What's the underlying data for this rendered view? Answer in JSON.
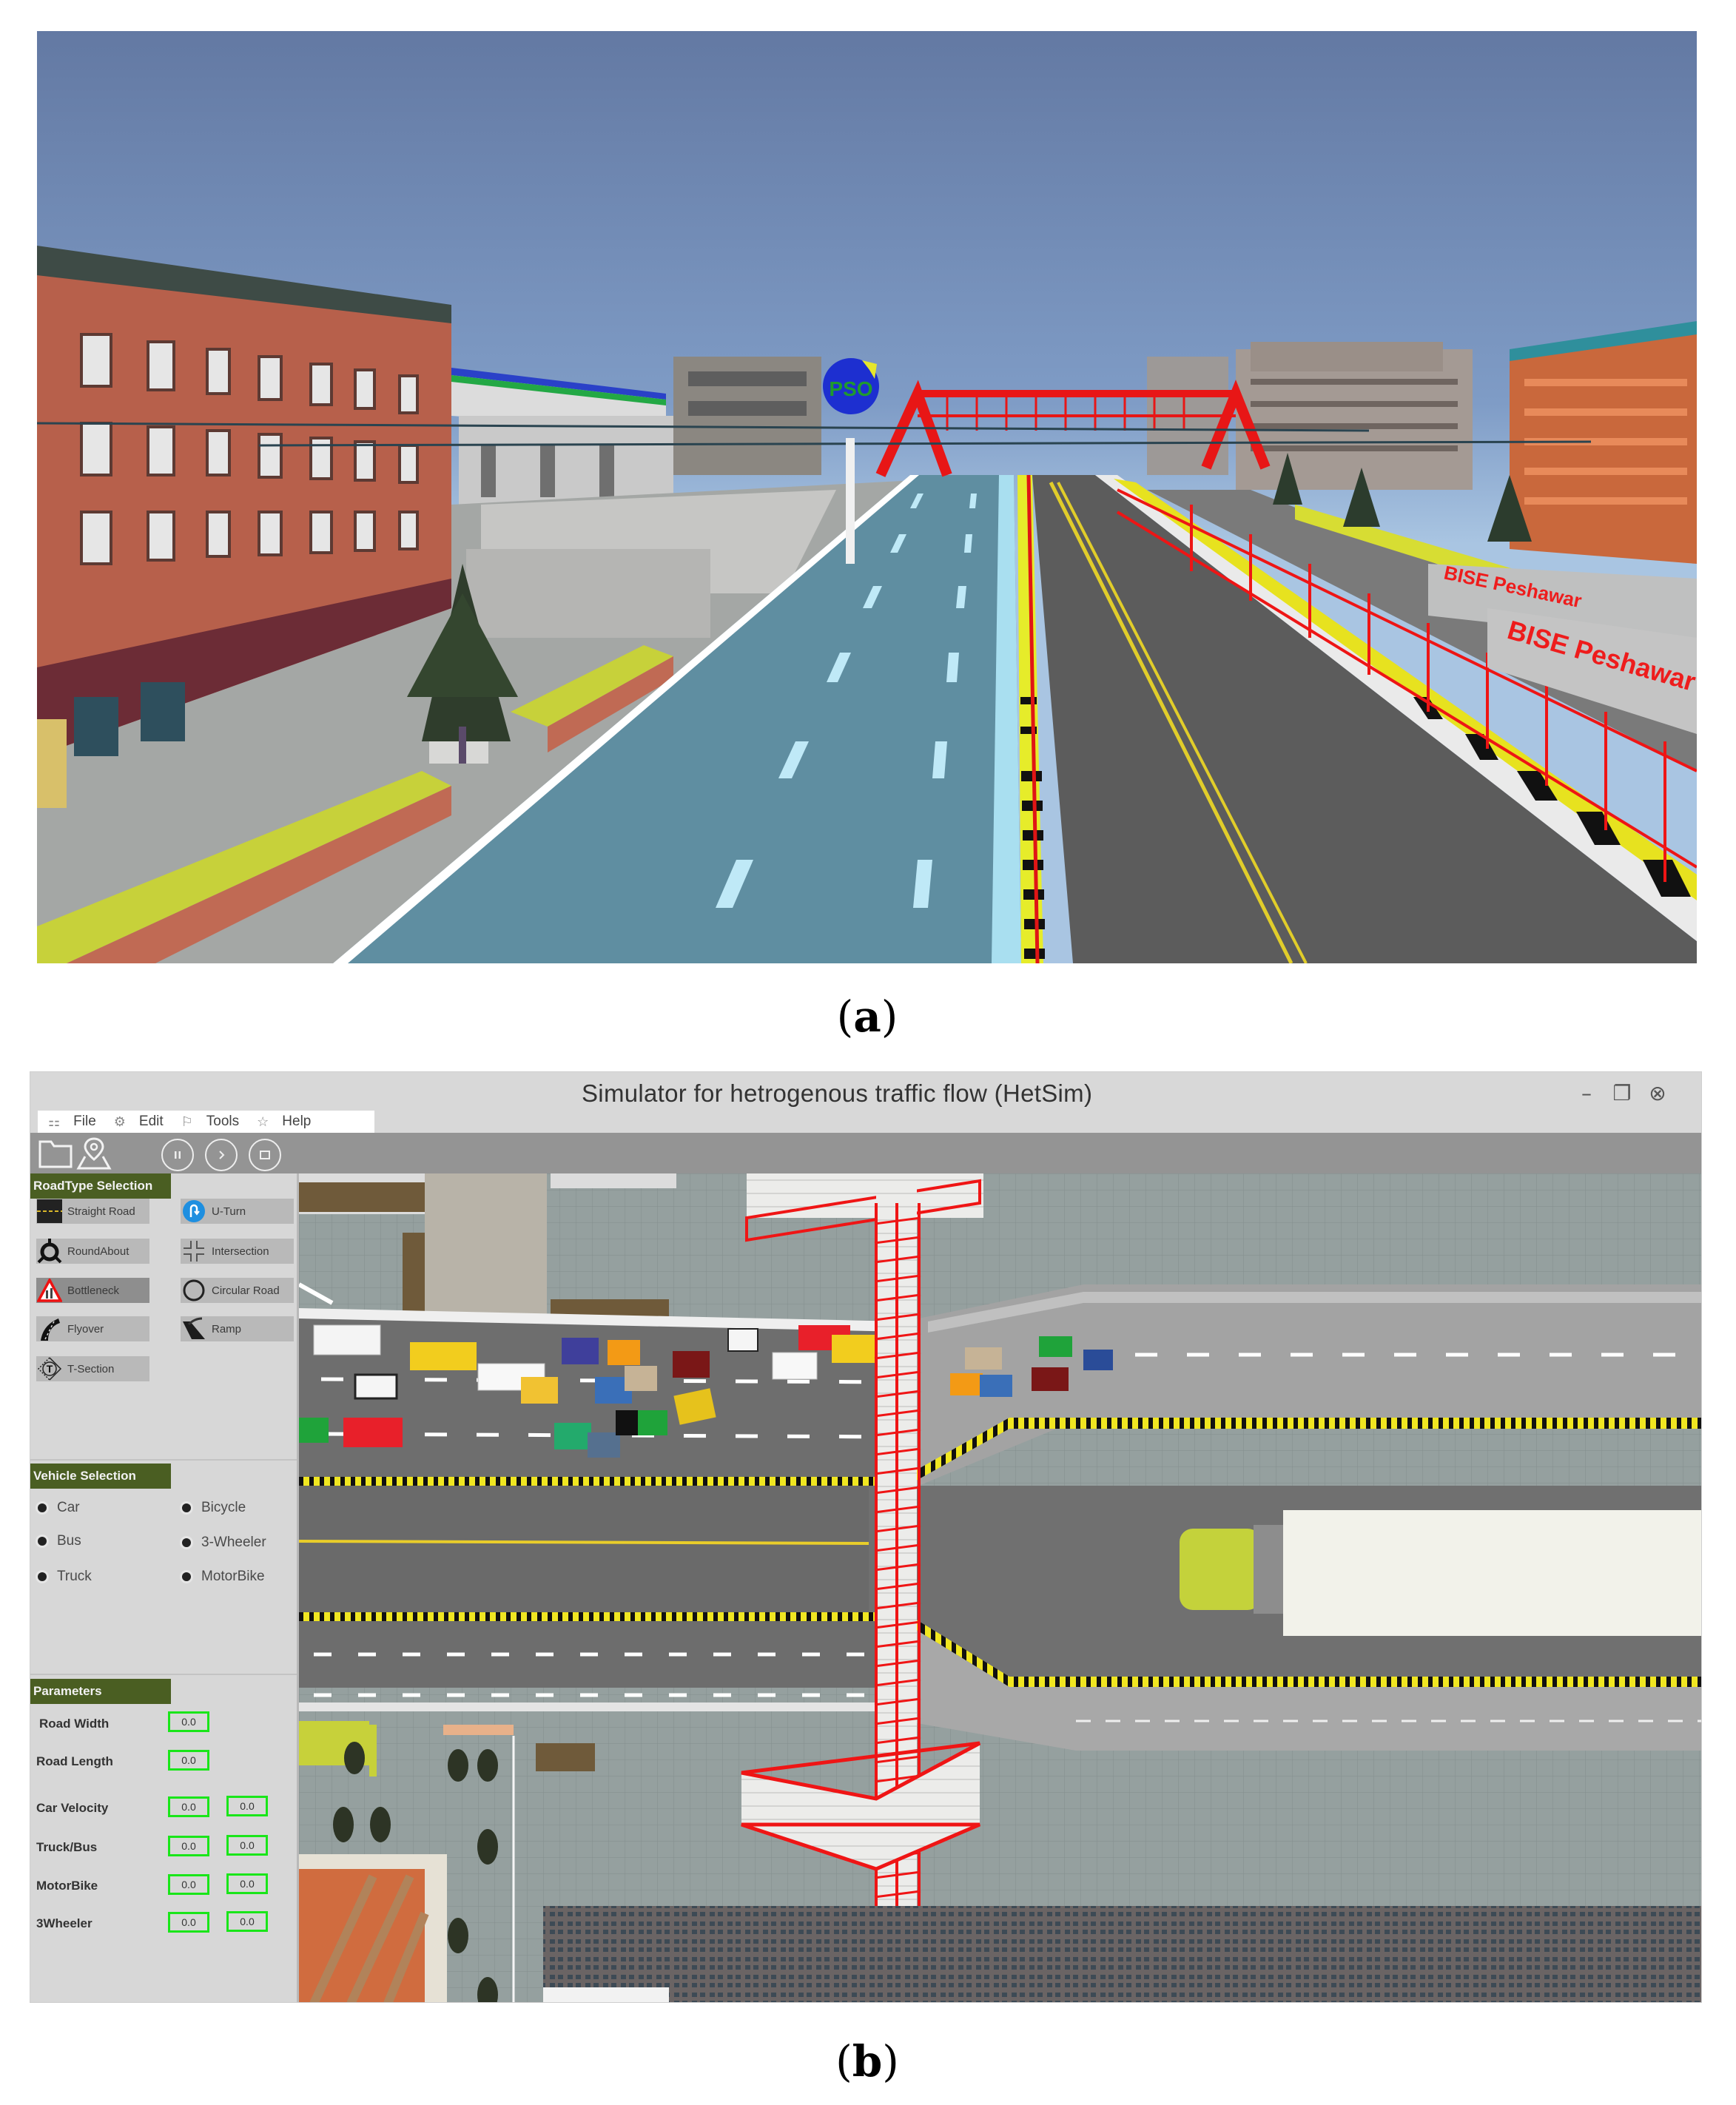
{
  "figure_a": {
    "caption_letter": "a",
    "scene": {
      "billboard_logo_text": "PSO",
      "wall_signs": [
        "BISE Peshawar",
        "BISE Peshawar"
      ]
    }
  },
  "figure_b": {
    "caption_letter": "b",
    "window": {
      "title": "Simulator for hetrogenous traffic flow  (HetSim)",
      "controls": {
        "minimize": "–",
        "restore": "❐",
        "close": "⊗"
      }
    },
    "menu": [
      {
        "icon": "grid-icon",
        "glyph": "⚏",
        "label": "File"
      },
      {
        "icon": "gear-icon",
        "glyph": "⚙",
        "label": "Edit"
      },
      {
        "icon": "flag-icon",
        "glyph": "⚐",
        "label": "Tools"
      },
      {
        "icon": "star-icon",
        "glyph": "☆",
        "label": "Help"
      }
    ],
    "toolbar": {
      "buttons": [
        "open-folder",
        "map-location",
        "pause",
        "play",
        "stop"
      ]
    },
    "road_type_selection": {
      "header": "RoadType Selection",
      "items": [
        {
          "label": "Straight Road",
          "icon": "straight-road-icon",
          "selected": false
        },
        {
          "label": "U-Turn",
          "icon": "u-turn-icon",
          "selected": false
        },
        {
          "label": "RoundAbout",
          "icon": "roundabout-icon",
          "selected": false
        },
        {
          "label": "Intersection",
          "icon": "intersection-icon",
          "selected": false
        },
        {
          "label": "Bottleneck",
          "icon": "bottleneck-warning-icon",
          "selected": true
        },
        {
          "label": "Circular Road",
          "icon": "circle-icon",
          "selected": false
        },
        {
          "label": "Flyover",
          "icon": "flyover-icon",
          "selected": false
        },
        {
          "label": "Ramp",
          "icon": "ramp-icon",
          "selected": false
        },
        {
          "label": "T-Section",
          "icon": "t-section-icon",
          "selected": false
        }
      ]
    },
    "vehicle_selection": {
      "header": "Vehicle Selection",
      "items": [
        "Car",
        "Bicycle",
        "Bus",
        "3-Wheeler",
        "Truck",
        "MotorBike"
      ]
    },
    "parameters": {
      "header": "Parameters",
      "rows": [
        {
          "label": "Road Width",
          "values": [
            "0.0"
          ]
        },
        {
          "label": "Road Length",
          "values": [
            "0.0"
          ]
        },
        {
          "label": "Car Velocity",
          "values": [
            "0.0",
            "0.0"
          ]
        },
        {
          "label": "Truck/Bus",
          "values": [
            "0.0",
            "0.0"
          ]
        },
        {
          "label": "MotorBike",
          "values": [
            "0.0",
            "0.0"
          ]
        },
        {
          "label": "3Wheeler",
          "values": [
            "0.0",
            "0.0"
          ]
        }
      ]
    },
    "colors": {
      "section_header": "#4a5e22",
      "input_border": "#19e619",
      "panel_bg": "#d7d7d7",
      "toolbar_bg": "#949494"
    }
  }
}
